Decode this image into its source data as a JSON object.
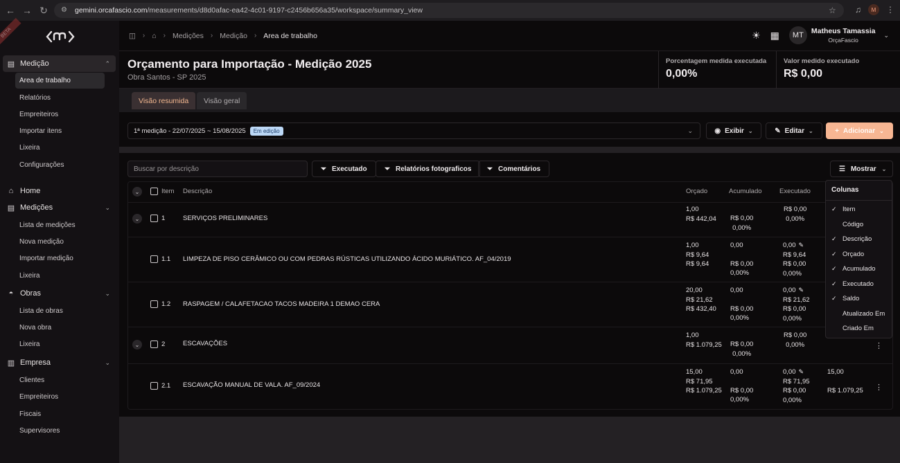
{
  "browser": {
    "url_domain": "gemini.orcafascio.com",
    "url_path": "/measurements/d8d0afac-ea42-4c01-9197-c2456b656a35/workspace/summary_view",
    "avatar_initial": "M"
  },
  "sidebar": {
    "beta": "BETA",
    "groups": [
      {
        "label": "Medição",
        "items": [
          "Area de trabalho",
          "Relatórios",
          "Empreiteiros",
          "Importar itens",
          "Lixeira",
          "Configurações"
        ]
      },
      {
        "label": "Home"
      },
      {
        "label": "Medições",
        "items": [
          "Lista de medições",
          "Nova medição",
          "Importar medição",
          "Lixeira"
        ]
      },
      {
        "label": "Obras",
        "items": [
          "Lista de obras",
          "Nova obra",
          "Lixeira"
        ]
      },
      {
        "label": "Empresa",
        "items": [
          "Clientes",
          "Empreiteiros",
          "Fiscais",
          "Supervisores"
        ]
      }
    ]
  },
  "breadcrumb": [
    "Medições",
    "Medição",
    "Area de trabalho"
  ],
  "user": {
    "initials": "MT",
    "name": "Matheus Tamassia",
    "org": "OrçaFascio"
  },
  "header": {
    "title": "Orçamento para Importação - Medição 2025",
    "subtitle": "Obra Santos - SP 2025",
    "metrics": [
      {
        "label": "Porcentagem medida executada",
        "value": "0,00%"
      },
      {
        "label": "Valor medido executado",
        "value": "R$ 0,00"
      }
    ]
  },
  "tabs": [
    "Visão resumida",
    "Visão geral"
  ],
  "period": {
    "label": "1ª medição - 22/07/2025 ~ 15/08/2025",
    "badge": "Em edição"
  },
  "actions": {
    "show": "Exibir",
    "edit": "Editar",
    "add": "Adicionar"
  },
  "search": {
    "placeholder": "Buscar por descrição"
  },
  "filters": [
    "Executado",
    "Relatórios fotograficos",
    "Comentários"
  ],
  "mostrar": "Mostrar",
  "table": {
    "headers": {
      "item": "Item",
      "descricao": "Descrição",
      "orcado": "Orçado",
      "acumulado": "Acumulado",
      "executado": "Executado"
    },
    "rows": [
      {
        "item": "1",
        "desc": "SERVIÇOS PRELIMINARES",
        "orcado": [
          "1,00",
          "R$ 442,04"
        ],
        "acumulado": [
          "R$ 0,00",
          "0,00%"
        ],
        "executado": [
          "R$ 0,00",
          "0,00%"
        ],
        "saldo": []
      },
      {
        "item": "1.1",
        "desc": "LIMPEZA DE PISO CERÂMICO OU COM PEDRAS RÚSTICAS UTILIZANDO ÁCIDO MURIÁTICO. AF_04/2019",
        "orcado": [
          "1,00",
          "R$ 9,64",
          "R$ 9,64"
        ],
        "acumulado": [
          "0,00",
          "R$ 0,00",
          "0,00%"
        ],
        "executado": [
          "0,00",
          "R$ 9,64",
          "R$ 0,00",
          "0,00%"
        ],
        "saldo": []
      },
      {
        "item": "1.2",
        "desc": "RASPAGEM / CALAFETACAO TACOS MADEIRA 1 DEMAO CERA",
        "orcado": [
          "20,00",
          "R$ 21,62",
          "R$ 432,40"
        ],
        "acumulado": [
          "0,00",
          "R$ 0,00",
          "0,00%"
        ],
        "executado": [
          "0,00",
          "R$ 21,62",
          "R$ 0,00",
          "0,00%"
        ],
        "saldo": []
      },
      {
        "item": "2",
        "desc": "ESCAVAÇÕES",
        "orcado": [
          "1,00",
          "R$ 1.079,25"
        ],
        "acumulado": [
          "R$ 0,00",
          "0,00%"
        ],
        "executado": [
          "R$ 0,00",
          "0,00%"
        ],
        "saldo": []
      },
      {
        "item": "2.1",
        "desc": "ESCAVAÇÃO MANUAL DE VALA. AF_09/2024",
        "orcado": [
          "15,00",
          "R$ 71,95",
          "R$ 1.079,25"
        ],
        "acumulado": [
          "0,00",
          "R$ 0,00",
          "0,00%"
        ],
        "executado": [
          "0,00",
          "R$ 71,95",
          "R$ 0,00",
          "0,00%"
        ],
        "saldo": [
          "15,00",
          "R$ 1.079,25"
        ]
      }
    ]
  },
  "columns_menu": {
    "title": "Colunas",
    "items": [
      {
        "label": "Item",
        "checked": true
      },
      {
        "label": "Código",
        "checked": false
      },
      {
        "label": "Descrição",
        "checked": true
      },
      {
        "label": "Orçado",
        "checked": true
      },
      {
        "label": "Acumulado",
        "checked": true
      },
      {
        "label": "Executado",
        "checked": true
      },
      {
        "label": "Saldo",
        "checked": true
      },
      {
        "label": "Atualizado Em",
        "checked": false
      },
      {
        "label": "Criado Em",
        "checked": false
      }
    ]
  }
}
